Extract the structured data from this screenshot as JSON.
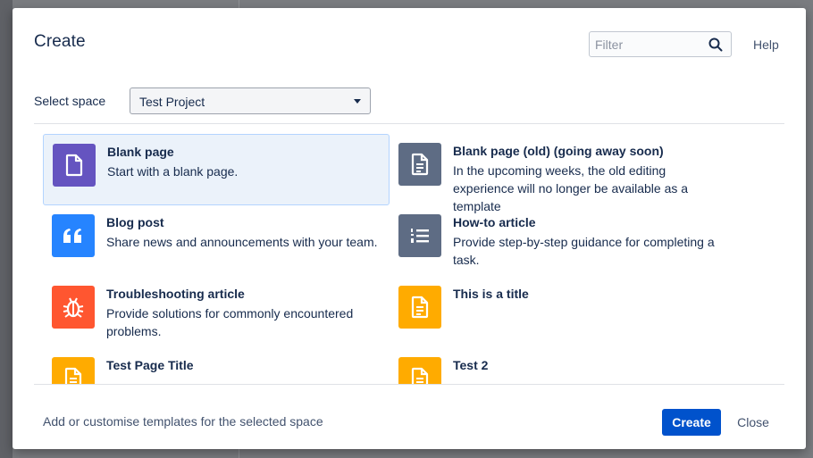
{
  "dialog": {
    "title": "Create",
    "filter_placeholder": "Filter",
    "help_label": "Help"
  },
  "space": {
    "label": "Select space",
    "selected": "Test Project"
  },
  "templates": [
    {
      "name": "Blank page",
      "description": "Start with a blank page.",
      "icon": "blank-page-icon",
      "color": "#6554c0",
      "selected": true
    },
    {
      "name": "Blank page (old) (going away soon)",
      "description": "In the upcoming weeks, the old editing experience will no longer be available as a template",
      "icon": "document-icon",
      "color": "#5e6c84",
      "selected": false
    },
    {
      "name": "Blog post",
      "description": "Share news and announcements with your team.",
      "icon": "quote-icon",
      "color": "#2684ff",
      "selected": false
    },
    {
      "name": "How-to article",
      "description": "Provide step-by-step guidance for completing a task.",
      "icon": "numbered-list-icon",
      "color": "#5e6c84",
      "selected": false
    },
    {
      "name": "Troubleshooting article",
      "description": "Provide solutions for commonly encountered problems.",
      "icon": "bug-icon",
      "color": "#ff5630",
      "selected": false
    },
    {
      "name": "This is a title",
      "description": "",
      "icon": "document-icon",
      "color": "#ffab00",
      "selected": false
    },
    {
      "name": "Test Page Title",
      "description": "",
      "icon": "document-icon",
      "color": "#ffab00",
      "selected": false
    },
    {
      "name": "Test 2",
      "description": "",
      "icon": "document-icon",
      "color": "#ffab00",
      "selected": false
    }
  ],
  "footer": {
    "customise_link": "Add or customise templates for the selected space",
    "create_label": "Create",
    "close_label": "Close"
  },
  "colors": {
    "primary": "#0052cc",
    "selected_bg": "#ebf2fa"
  }
}
